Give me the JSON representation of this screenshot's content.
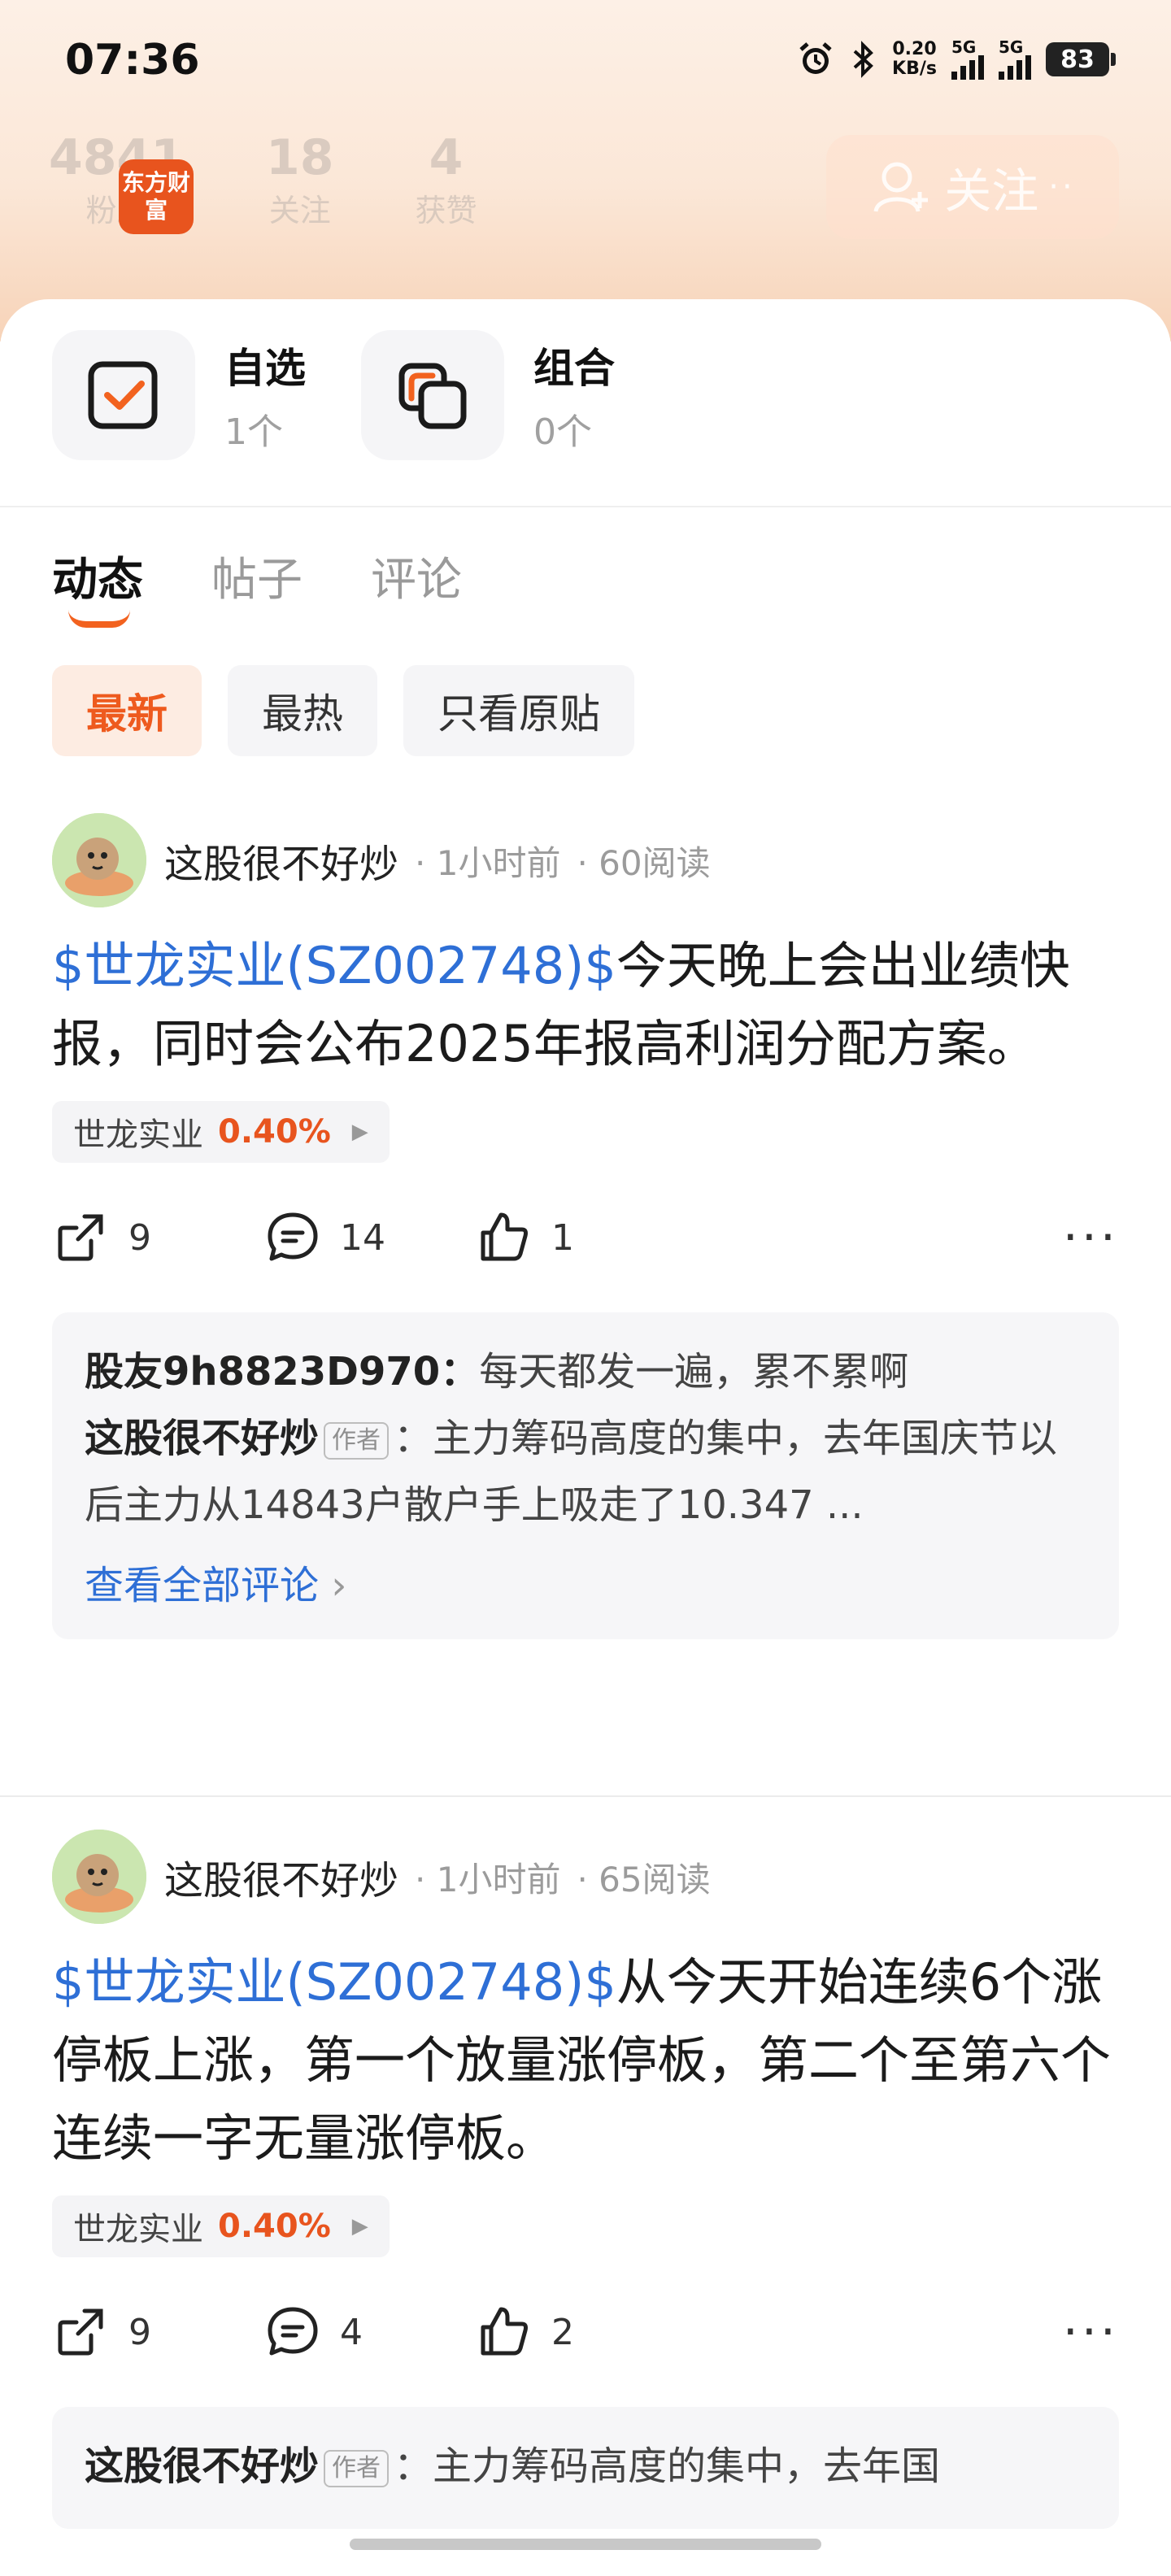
{
  "status": {
    "time": "07:36",
    "net_speed_value": "0.20",
    "net_speed_unit": "KB/s",
    "sim1": "5G",
    "sim2": "5G",
    "battery": "83"
  },
  "profile": {
    "stats": [
      {
        "num": "4841",
        "label": "粉丝"
      },
      {
        "num": "18",
        "label": "关注"
      },
      {
        "num": "4",
        "label": "获赞"
      }
    ],
    "app_logo": "东方财富",
    "follow_label": "关注"
  },
  "quick": [
    {
      "title": "自选",
      "sub": "1个"
    },
    {
      "title": "组合",
      "sub": "0个"
    }
  ],
  "tabs": [
    "动态",
    "帖子",
    "评论"
  ],
  "filters": [
    "最新",
    "最热",
    "只看原贴"
  ],
  "posts": [
    {
      "author": "这股很不好炒",
      "time": "1小时前",
      "reads": "60阅读",
      "tag": "$世龙实业(SZ002748)$",
      "text": "今天晚上会出业绩快报，同时会公布2025年报高利润分配方案。",
      "stock_name": "世龙实业",
      "stock_pct": "0.40%",
      "shares": "9",
      "comments_count": "14",
      "likes": "1",
      "comments": [
        {
          "user": "股友9h8823D970：",
          "text": "每天都发一遍，累不累啊"
        },
        {
          "user": "这股很不好炒",
          "badge": "作者",
          "text": "：主力筹码高度的集中，去年国庆节以后主力从14843户散户手上吸走了10.347 ..."
        }
      ],
      "view_all": "查看全部评论"
    },
    {
      "author": "这股很不好炒",
      "time": "1小时前",
      "reads": "65阅读",
      "tag": "$世龙实业(SZ002748)$",
      "text": "从今天开始连续6个涨停板上涨，第一个放量涨停板，第二个至第六个连续一字无量涨停板。",
      "stock_name": "世龙实业",
      "stock_pct": "0.40%",
      "shares": "9",
      "comments_count": "4",
      "likes": "2",
      "comments": [
        {
          "user": "这股很不好炒",
          "badge": "作者",
          "text": "：主力筹码高度的集中，去年国"
        }
      ]
    }
  ]
}
